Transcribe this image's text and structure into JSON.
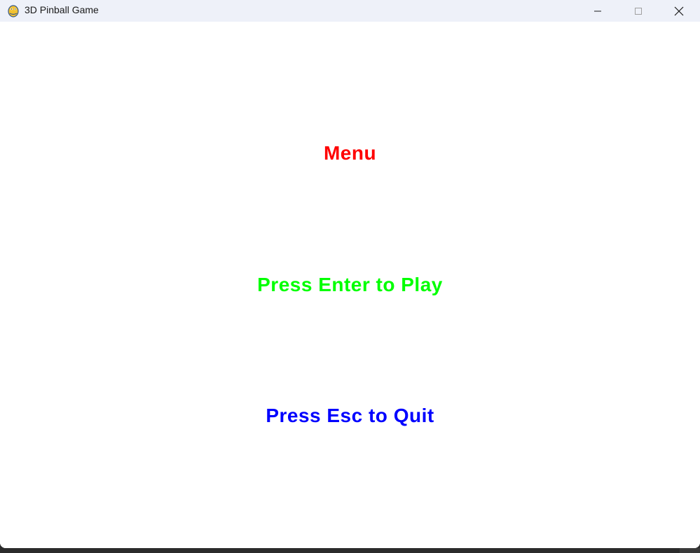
{
  "window": {
    "title": "3D Pinball Game",
    "app_icon": "pygame-snake-icon",
    "controls": {
      "minimize_icon": "minimize-icon",
      "maximize_icon": "maximize-icon",
      "close_icon": "close-icon"
    }
  },
  "menu": {
    "title": "Menu",
    "play_hint": "Press Enter to Play",
    "quit_hint": "Press Esc to Quit"
  },
  "colors": {
    "background": "#ffffff",
    "title_color": "#ff0000",
    "play_color": "#00ff00",
    "quit_color": "#0000ff",
    "titlebar": "#eef1f9"
  }
}
